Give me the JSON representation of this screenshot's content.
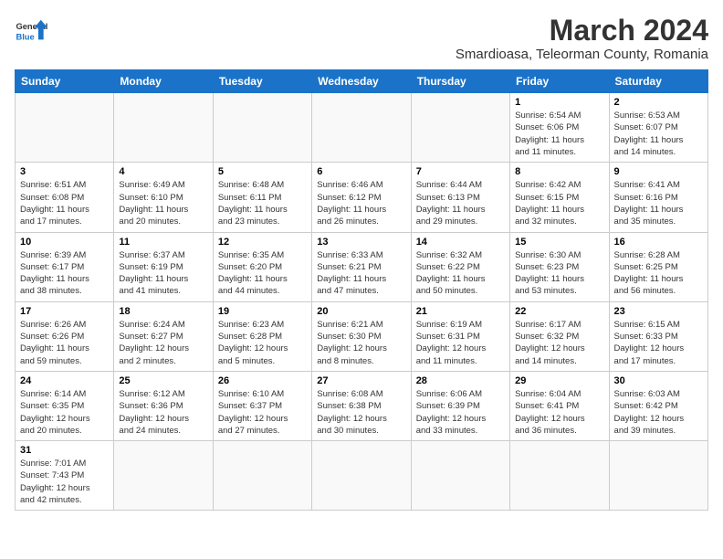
{
  "header": {
    "logo_general": "General",
    "logo_blue": "Blue",
    "month_year": "March 2024",
    "location": "Smardioasa, Teleorman County, Romania"
  },
  "weekdays": [
    "Sunday",
    "Monday",
    "Tuesday",
    "Wednesday",
    "Thursday",
    "Friday",
    "Saturday"
  ],
  "weeks": [
    [
      {
        "day": "",
        "info": ""
      },
      {
        "day": "",
        "info": ""
      },
      {
        "day": "",
        "info": ""
      },
      {
        "day": "",
        "info": ""
      },
      {
        "day": "",
        "info": ""
      },
      {
        "day": "1",
        "info": "Sunrise: 6:54 AM\nSunset: 6:06 PM\nDaylight: 11 hours\nand 11 minutes."
      },
      {
        "day": "2",
        "info": "Sunrise: 6:53 AM\nSunset: 6:07 PM\nDaylight: 11 hours\nand 14 minutes."
      }
    ],
    [
      {
        "day": "3",
        "info": "Sunrise: 6:51 AM\nSunset: 6:08 PM\nDaylight: 11 hours\nand 17 minutes."
      },
      {
        "day": "4",
        "info": "Sunrise: 6:49 AM\nSunset: 6:10 PM\nDaylight: 11 hours\nand 20 minutes."
      },
      {
        "day": "5",
        "info": "Sunrise: 6:48 AM\nSunset: 6:11 PM\nDaylight: 11 hours\nand 23 minutes."
      },
      {
        "day": "6",
        "info": "Sunrise: 6:46 AM\nSunset: 6:12 PM\nDaylight: 11 hours\nand 26 minutes."
      },
      {
        "day": "7",
        "info": "Sunrise: 6:44 AM\nSunset: 6:13 PM\nDaylight: 11 hours\nand 29 minutes."
      },
      {
        "day": "8",
        "info": "Sunrise: 6:42 AM\nSunset: 6:15 PM\nDaylight: 11 hours\nand 32 minutes."
      },
      {
        "day": "9",
        "info": "Sunrise: 6:41 AM\nSunset: 6:16 PM\nDaylight: 11 hours\nand 35 minutes."
      }
    ],
    [
      {
        "day": "10",
        "info": "Sunrise: 6:39 AM\nSunset: 6:17 PM\nDaylight: 11 hours\nand 38 minutes."
      },
      {
        "day": "11",
        "info": "Sunrise: 6:37 AM\nSunset: 6:19 PM\nDaylight: 11 hours\nand 41 minutes."
      },
      {
        "day": "12",
        "info": "Sunrise: 6:35 AM\nSunset: 6:20 PM\nDaylight: 11 hours\nand 44 minutes."
      },
      {
        "day": "13",
        "info": "Sunrise: 6:33 AM\nSunset: 6:21 PM\nDaylight: 11 hours\nand 47 minutes."
      },
      {
        "day": "14",
        "info": "Sunrise: 6:32 AM\nSunset: 6:22 PM\nDaylight: 11 hours\nand 50 minutes."
      },
      {
        "day": "15",
        "info": "Sunrise: 6:30 AM\nSunset: 6:23 PM\nDaylight: 11 hours\nand 53 minutes."
      },
      {
        "day": "16",
        "info": "Sunrise: 6:28 AM\nSunset: 6:25 PM\nDaylight: 11 hours\nand 56 minutes."
      }
    ],
    [
      {
        "day": "17",
        "info": "Sunrise: 6:26 AM\nSunset: 6:26 PM\nDaylight: 11 hours\nand 59 minutes."
      },
      {
        "day": "18",
        "info": "Sunrise: 6:24 AM\nSunset: 6:27 PM\nDaylight: 12 hours\nand 2 minutes."
      },
      {
        "day": "19",
        "info": "Sunrise: 6:23 AM\nSunset: 6:28 PM\nDaylight: 12 hours\nand 5 minutes."
      },
      {
        "day": "20",
        "info": "Sunrise: 6:21 AM\nSunset: 6:30 PM\nDaylight: 12 hours\nand 8 minutes."
      },
      {
        "day": "21",
        "info": "Sunrise: 6:19 AM\nSunset: 6:31 PM\nDaylight: 12 hours\nand 11 minutes."
      },
      {
        "day": "22",
        "info": "Sunrise: 6:17 AM\nSunset: 6:32 PM\nDaylight: 12 hours\nand 14 minutes."
      },
      {
        "day": "23",
        "info": "Sunrise: 6:15 AM\nSunset: 6:33 PM\nDaylight: 12 hours\nand 17 minutes."
      }
    ],
    [
      {
        "day": "24",
        "info": "Sunrise: 6:14 AM\nSunset: 6:35 PM\nDaylight: 12 hours\nand 20 minutes."
      },
      {
        "day": "25",
        "info": "Sunrise: 6:12 AM\nSunset: 6:36 PM\nDaylight: 12 hours\nand 24 minutes."
      },
      {
        "day": "26",
        "info": "Sunrise: 6:10 AM\nSunset: 6:37 PM\nDaylight: 12 hours\nand 27 minutes."
      },
      {
        "day": "27",
        "info": "Sunrise: 6:08 AM\nSunset: 6:38 PM\nDaylight: 12 hours\nand 30 minutes."
      },
      {
        "day": "28",
        "info": "Sunrise: 6:06 AM\nSunset: 6:39 PM\nDaylight: 12 hours\nand 33 minutes."
      },
      {
        "day": "29",
        "info": "Sunrise: 6:04 AM\nSunset: 6:41 PM\nDaylight: 12 hours\nand 36 minutes."
      },
      {
        "day": "30",
        "info": "Sunrise: 6:03 AM\nSunset: 6:42 PM\nDaylight: 12 hours\nand 39 minutes."
      }
    ],
    [
      {
        "day": "31",
        "info": "Sunrise: 7:01 AM\nSunset: 7:43 PM\nDaylight: 12 hours\nand 42 minutes."
      },
      {
        "day": "",
        "info": ""
      },
      {
        "day": "",
        "info": ""
      },
      {
        "day": "",
        "info": ""
      },
      {
        "day": "",
        "info": ""
      },
      {
        "day": "",
        "info": ""
      },
      {
        "day": "",
        "info": ""
      }
    ]
  ]
}
